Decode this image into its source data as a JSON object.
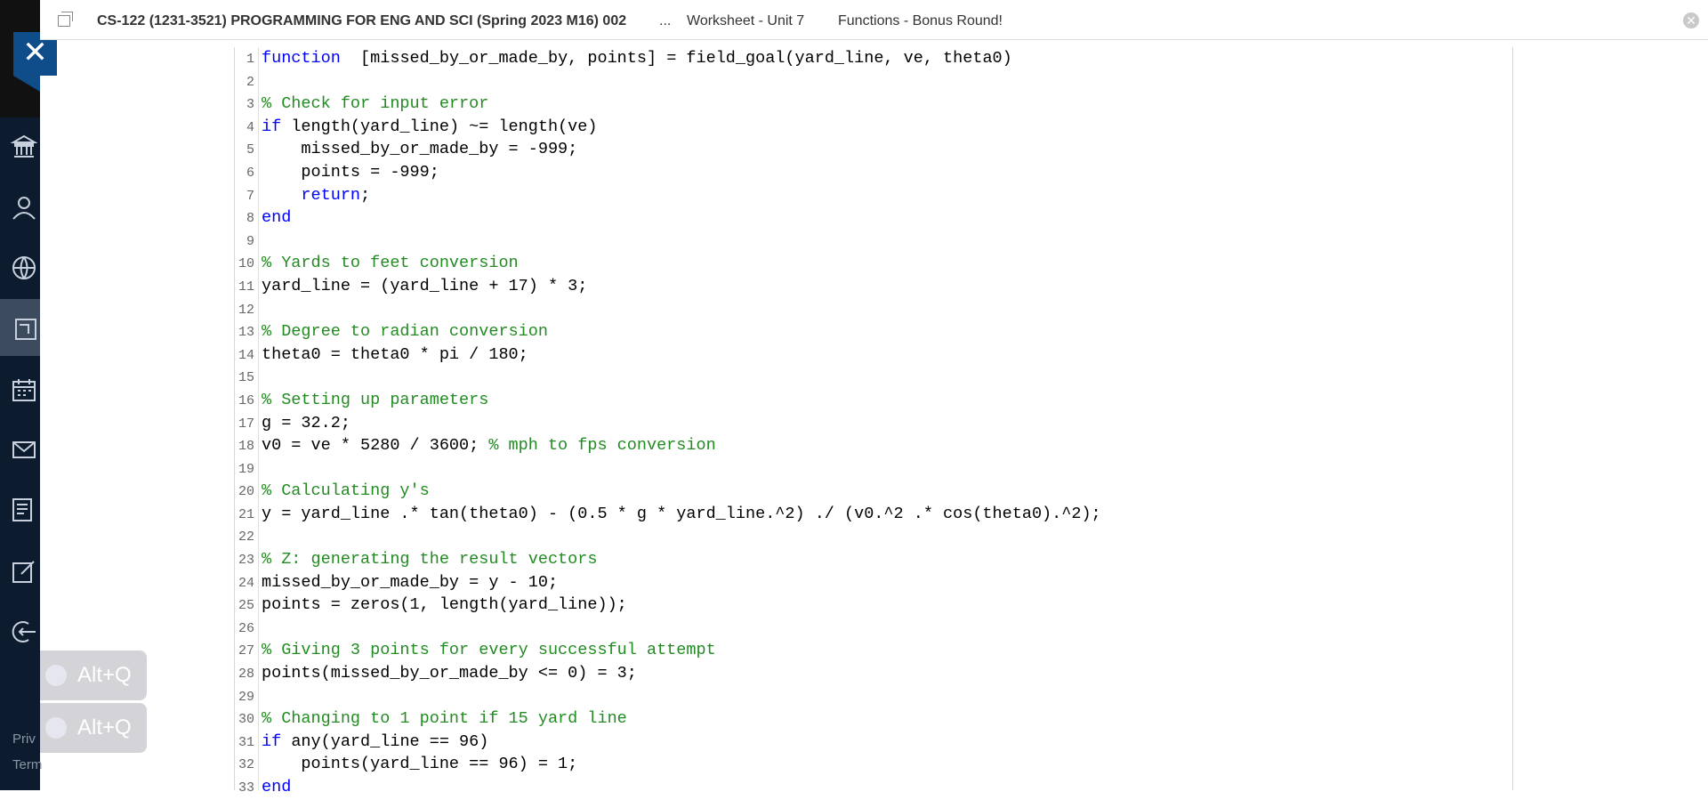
{
  "header": {
    "course_title": "CS-122 (1231-3521) PROGRAMMING FOR ENG AND SCI (Spring 2023 M16) 002",
    "ellipsis": "...",
    "crumb_worksheet": "Worksheet - Unit 7",
    "crumb_page": "Functions - Bonus Round!"
  },
  "sidebar": {
    "footer_privacy": "Priv",
    "footer_terms": "Term"
  },
  "altq": {
    "label1": "Alt+Q",
    "label2": "Alt+Q"
  },
  "code_lines": [
    {
      "n": "1",
      "parts": [
        [
          "kw",
          "function"
        ],
        [
          "",
          "  [missed_by_or_made_by, points] = field_goal(yard_line, ve, theta0)"
        ]
      ]
    },
    {
      "n": "2",
      "parts": []
    },
    {
      "n": "3",
      "parts": [
        [
          "cm",
          "% Check for input error"
        ]
      ]
    },
    {
      "n": "4",
      "parts": [
        [
          "kw",
          "if"
        ],
        [
          "",
          " length(yard_line) ~= length(ve)"
        ]
      ]
    },
    {
      "n": "5",
      "parts": [
        [
          "",
          "    missed_by_or_made_by = -999;"
        ]
      ]
    },
    {
      "n": "6",
      "parts": [
        [
          "",
          "    points = -999;"
        ]
      ]
    },
    {
      "n": "7",
      "parts": [
        [
          "",
          "    "
        ],
        [
          "kw",
          "return"
        ],
        [
          "",
          ";"
        ]
      ]
    },
    {
      "n": "8",
      "parts": [
        [
          "kw",
          "end"
        ]
      ]
    },
    {
      "n": "9",
      "parts": []
    },
    {
      "n": "10",
      "parts": [
        [
          "cm",
          "% Yards to feet conversion"
        ]
      ]
    },
    {
      "n": "11",
      "parts": [
        [
          "",
          "yard_line = (yard_line + 17) * 3;"
        ]
      ]
    },
    {
      "n": "12",
      "parts": []
    },
    {
      "n": "13",
      "parts": [
        [
          "cm",
          "% Degree to radian conversion"
        ]
      ]
    },
    {
      "n": "14",
      "parts": [
        [
          "",
          "theta0 = theta0 * pi / 180;"
        ]
      ]
    },
    {
      "n": "15",
      "parts": []
    },
    {
      "n": "16",
      "parts": [
        [
          "cm",
          "% Setting up parameters"
        ]
      ]
    },
    {
      "n": "17",
      "parts": [
        [
          "",
          "g = 32.2;"
        ]
      ]
    },
    {
      "n": "18",
      "parts": [
        [
          "",
          "v0 = ve * 5280 / 3600; "
        ],
        [
          "cm",
          "% mph to fps conversion"
        ]
      ]
    },
    {
      "n": "19",
      "parts": []
    },
    {
      "n": "20",
      "parts": [
        [
          "cm",
          "% Calculating y's"
        ]
      ]
    },
    {
      "n": "21",
      "parts": [
        [
          "",
          "y = yard_line .* tan(theta0) - (0.5 * g * yard_line.^2) ./ (v0.^2 .* cos(theta0).^2);"
        ]
      ]
    },
    {
      "n": "22",
      "parts": []
    },
    {
      "n": "23",
      "parts": [
        [
          "cm",
          "% Z: generating the result vectors"
        ]
      ]
    },
    {
      "n": "24",
      "parts": [
        [
          "",
          "missed_by_or_made_by = y - 10;"
        ]
      ]
    },
    {
      "n": "25",
      "parts": [
        [
          "",
          "points = zeros(1, length(yard_line));"
        ]
      ]
    },
    {
      "n": "26",
      "parts": []
    },
    {
      "n": "27",
      "parts": [
        [
          "cm",
          "% Giving 3 points for every successful attempt"
        ]
      ]
    },
    {
      "n": "28",
      "parts": [
        [
          "",
          "points(missed_by_or_made_by <= 0) = 3;"
        ]
      ]
    },
    {
      "n": "29",
      "parts": []
    },
    {
      "n": "30",
      "parts": [
        [
          "cm",
          "% Changing to 1 point if 15 yard line"
        ]
      ]
    },
    {
      "n": "31",
      "parts": [
        [
          "kw",
          "if"
        ],
        [
          "",
          " any(yard_line == 96)"
        ]
      ]
    },
    {
      "n": "32",
      "parts": [
        [
          "",
          "    points(yard_line == 96) = 1;"
        ]
      ]
    },
    {
      "n": "33",
      "parts": [
        [
          "kw",
          "end"
        ]
      ]
    }
  ]
}
